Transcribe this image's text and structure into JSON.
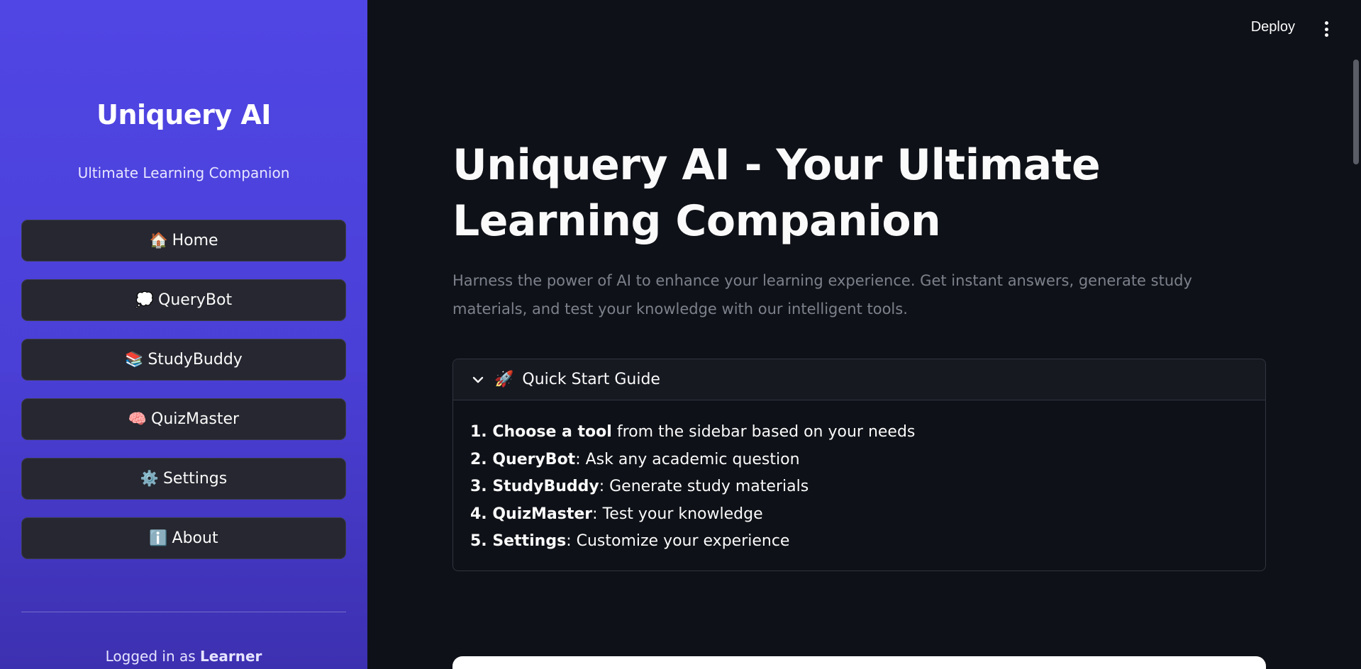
{
  "sidebar": {
    "title": "Uniquery AI",
    "subtitle": "Ultimate Learning Companion",
    "nav": [
      {
        "icon": "house-icon",
        "emoji": "🏠",
        "label": "Home"
      },
      {
        "icon": "speech-bubble-icon",
        "emoji": "💭",
        "label": "QueryBot"
      },
      {
        "icon": "books-icon",
        "emoji": "📚",
        "label": "StudyBuddy"
      },
      {
        "icon": "brain-icon",
        "emoji": "🧠",
        "label": "QuizMaster"
      },
      {
        "icon": "gear-icon",
        "emoji": "⚙️",
        "label": "Settings"
      },
      {
        "icon": "info-icon",
        "emoji": "ℹ️",
        "label": "About"
      }
    ],
    "logged_prefix": "Logged in as ",
    "logged_user": "Learner"
  },
  "header": {
    "deploy_label": "Deploy",
    "menu_icon": "kebab-menu-icon"
  },
  "main": {
    "title": "Uniquery AI - Your Ultimate Learning Companion",
    "description": "Harness the power of AI to enhance your learning experience. Get instant answers, generate study materials, and test your knowledge with our intelligent tools.",
    "expander": {
      "icon": "rocket-icon",
      "emoji": "🚀",
      "label": "Quick Start Guide",
      "steps": [
        {
          "num": "1. ",
          "bold": "Choose a tool",
          "text": " from the sidebar based on your needs"
        },
        {
          "num": "2. ",
          "bold": "QueryBot",
          "text": ": Ask any academic question"
        },
        {
          "num": "3. ",
          "bold": "StudyBuddy",
          "text": ": Generate study materials"
        },
        {
          "num": "4. ",
          "bold": "QuizMaster",
          "text": ": Test your knowledge"
        },
        {
          "num": "5. ",
          "bold": "Settings",
          "text": ": Customize your experience"
        }
      ]
    }
  },
  "colors": {
    "sidebar_gradient_top": "#5046e5",
    "sidebar_gradient_bottom": "#3d30b0",
    "main_bg": "#0e1117",
    "button_bg": "#262730"
  }
}
